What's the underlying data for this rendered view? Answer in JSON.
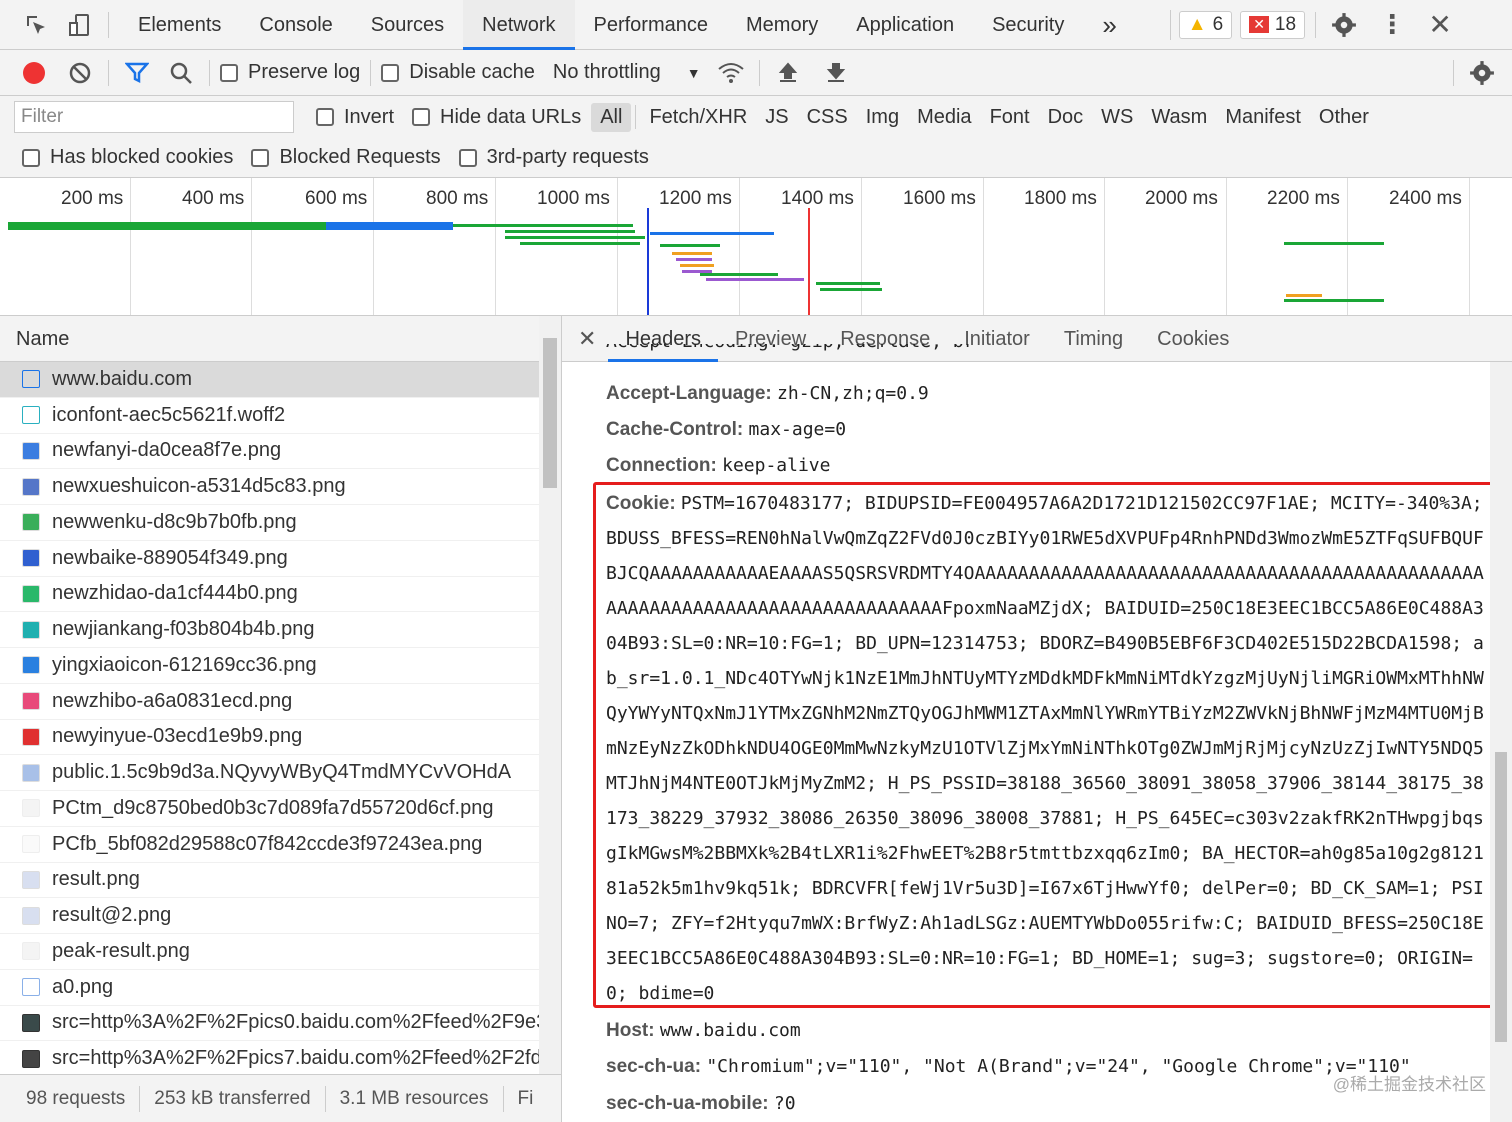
{
  "topbar": {
    "tabs": [
      "Elements",
      "Console",
      "Sources",
      "Network",
      "Performance",
      "Memory",
      "Application",
      "Security"
    ],
    "more": "»",
    "warnings": "6",
    "errors": "18"
  },
  "toolbar": {
    "preserve_log": "Preserve log",
    "disable_cache": "Disable cache",
    "throttling": "No throttling"
  },
  "filter": {
    "placeholder": "Filter",
    "invert": "Invert",
    "hide_data_urls": "Hide data URLs",
    "types": [
      "All",
      "Fetch/XHR",
      "JS",
      "CSS",
      "Img",
      "Media",
      "Font",
      "Doc",
      "WS",
      "Wasm",
      "Manifest",
      "Other"
    ],
    "has_blocked_cookies": "Has blocked cookies",
    "blocked_requests": "Blocked Requests",
    "third_party": "3rd-party requests"
  },
  "overview": {
    "ticks": [
      "200 ms",
      "400 ms",
      "600 ms",
      "800 ms",
      "1000 ms",
      "1200 ms",
      "1400 ms",
      "1600 ms",
      "1800 ms",
      "2000 ms",
      "2200 ms",
      "2400 ms"
    ]
  },
  "names": {
    "header": "Name",
    "items": [
      "www.baidu.com",
      "iconfont-aec5c5621f.woff2",
      "newfanyi-da0cea8f7e.png",
      "newxueshuicon-a5314d5c83.png",
      "newwenku-d8c9b7b0fb.png",
      "newbaike-889054f349.png",
      "newzhidao-da1cf444b0.png",
      "newjiankang-f03b804b4b.png",
      "yingxiaoicon-612169cc36.png",
      "newzhibo-a6a0831ecd.png",
      "newyinyue-03ecd1e9b9.png",
      "public.1.5c9b9d3a.NQyvyWByQ4TmdMYCvVOHdA",
      "PCtm_d9c8750bed0b3c7d089fa7d55720d6cf.png",
      "PCfb_5bf082d29588c07f842ccde3f97243ea.png",
      "result.png",
      "result@2.png",
      "peak-result.png",
      "a0.png",
      "src=http%3A%2F%2Fpics0.baidu.com%2Ffeed%2F9e3",
      "src=http%3A%2F%2Fpics7.baidu.com%2Ffeed%2F2fd."
    ]
  },
  "status": {
    "requests": "98 requests",
    "transferred": "253 kB transferred",
    "resources": "3.1 MB resources",
    "finish": "Fi"
  },
  "detail": {
    "tabs": [
      "Headers",
      "Preview",
      "Response",
      "Initiator",
      "Timing",
      "Cookies"
    ],
    "partial_line": "Accept-Encoding: gzip, deflate, br",
    "headers": [
      {
        "name": "Accept-Language:",
        "value": "zh-CN,zh;q=0.9"
      },
      {
        "name": "Cache-Control:",
        "value": "max-age=0"
      },
      {
        "name": "Connection:",
        "value": "keep-alive"
      }
    ],
    "cookie_name": "Cookie:",
    "cookie_value": "PSTM=1670483177; BIDUPSID=FE004957A6A2D1721D121502CC97F1AE; MCITY=-340%3A; BDUSS_BFESS=REN0hNalVwQmZqZ2FVd0J0czBIYy01RWE5dXVPUFp4RnhPNDd3WmozWmE5ZTFqSUFBQUFBJCQAAAAAAAAAAAEAAAAS5QSRSVRDMTY4OAAAAAAAAAAAAAAAAAAAAAAAAAAAAAAAAAAAAAAAAAAAAAAAAAAAAAAAAAAAAAAAAAAAAAAAAAAAAAAFpoxmNaaMZjdX; BAIDUID=250C18E3EEC1BCC5A86E0C488A304B93:SL=0:NR=10:FG=1; BD_UPN=12314753; BDORZ=B490B5EBF6F3CD402E515D22BCDA1598; ab_sr=1.0.1_NDc4OTYwNjk1NzE1MmJhNTUyMTYzMDdkMDFkMmNiMTdkYzgzMjUyNjliMGRiOWMxMThhNWQyYWYyNTQxNmJ1YTMxZGNhM2NmZTQyOGJhMWM1ZTAxMmNlYWRmYTBiYzM2ZWVkNjBhNWFjMzM4MTU0MjBmNzEyNzZkODhkNDU4OGE0MmMwNzkyMzU1OTVlZjMxYmNiNThkOTg0ZWJmMjRjMjcyNzUzZjIwNTY5NDQ5MTJhNjM4NTE0OTJkMjMyZmM2; H_PS_PSSID=38188_36560_38091_38058_37906_38144_38175_38173_38229_37932_38086_26350_38096_38008_37881; H_PS_645EC=c303v2zakfRK2nTHwpgjbqsgIkMGwsM%2BBMXk%2B4tLXR1i%2FhwEET%2B8r5tmttbzxqq6zIm0; BA_HECTOR=ah0g85a10g2g812181a52k5m1hv9kq51k; BDRCVFR[feWj1Vr5u3D]=I67x6TjHwwYf0; delPer=0; BD_CK_SAM=1; PSINO=7; ZFY=f2Htyqu7mWX:BrfWyZ:Ah1adLSGz:AUEMTYWbDo055rifw:C; BAIDUID_BFESS=250C18E3EEC1BCC5A86E0C488A304B93:SL=0:NR=10:FG=1; BD_HOME=1; sug=3; sugstore=0; ORIGIN=0; bdime=0",
    "after": [
      {
        "name": "Host:",
        "value": "www.baidu.com"
      },
      {
        "name": "sec-ch-ua:",
        "value": "\"Chromium\";v=\"110\", \"Not A(Brand\";v=\"24\", \"Google Chrome\";v=\"110\""
      },
      {
        "name": "sec-ch-ua-mobile:",
        "value": "?0"
      }
    ]
  },
  "watermark": "@稀土掘金技术社区",
  "colors": {
    "accent": "#1a73e8",
    "record": "#e33",
    "highlight_border": "#e51d1d",
    "warning": "#f4b400",
    "error": "#e53935"
  }
}
